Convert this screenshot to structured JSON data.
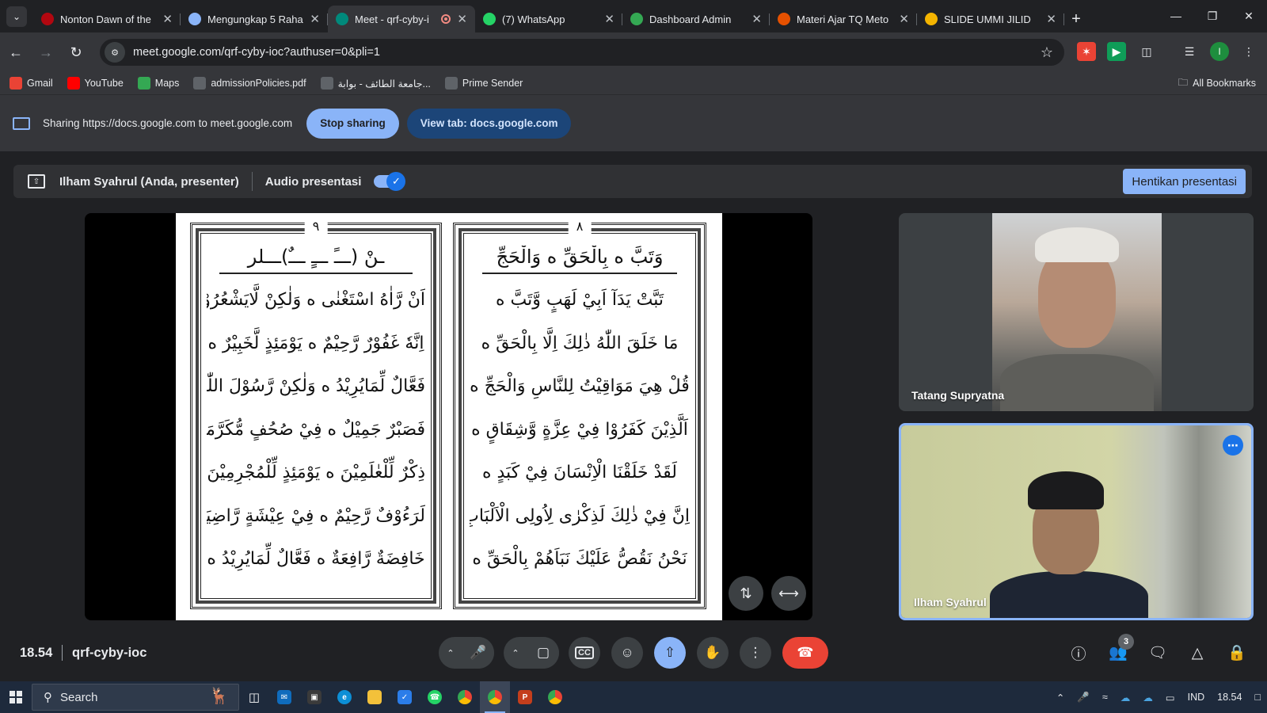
{
  "browser": {
    "tabs": [
      {
        "title": "Nonton Dawn of the",
        "favicon": "netflix-icon",
        "color": "#b20710"
      },
      {
        "title": "Mengungkap 5 Raha",
        "favicon": "sparkle-icon",
        "color": "#8ab4f8"
      },
      {
        "title": "Meet - qrf-cyby-i",
        "favicon": "meet-icon",
        "color": "#00897b",
        "active": true
      },
      {
        "title": "(7) WhatsApp",
        "favicon": "whatsapp-icon",
        "color": "#25d366"
      },
      {
        "title": "Dashboard Admin",
        "favicon": "dashboard-icon",
        "color": "#34a853"
      },
      {
        "title": "Materi Ajar TQ Meto",
        "favicon": "ummi-icon",
        "color": "#e65100"
      },
      {
        "title": "SLIDE UMMI JILID",
        "favicon": "slides-icon",
        "color": "#f4b400"
      }
    ],
    "url": "meet.google.com/qrf-cyby-ioc?authuser=0&pli=1",
    "profile_initial": "I",
    "bookmarks": [
      {
        "label": "Gmail",
        "icon": "gmail-icon",
        "color": "#ea4335"
      },
      {
        "label": "YouTube",
        "icon": "youtube-icon",
        "color": "#ff0000"
      },
      {
        "label": "Maps",
        "icon": "maps-icon",
        "color": "#34a853"
      },
      {
        "label": "admissionPolicies.pdf",
        "icon": "globe-icon",
        "color": "#5f6368"
      },
      {
        "label": "جامعة الطائف - بوابة...",
        "icon": "globe-icon",
        "color": "#5f6368"
      },
      {
        "label": "Prime Sender",
        "icon": "globe-icon",
        "color": "#5f6368"
      }
    ],
    "all_bookmarks": "All Bookmarks"
  },
  "sharing": {
    "text": "Sharing https://docs.google.com to meet.google.com",
    "stop_label": "Stop sharing",
    "view_label": "View tab: docs.google.com"
  },
  "meet": {
    "presenter_label": "Ilham Syahrul (Anda, presenter)",
    "audio_label": "Audio presentasi",
    "stop_presenting": "Hentikan presentasi",
    "doc": {
      "left_page_number": "٩",
      "right_page_number": "٨",
      "left_heading": "ـنْ (ـــً ـــٍ ـــٌ)ـــلر",
      "right_heading": "وَتَبَّ ﻩ بِالْحَقِّ ﻩ وَالْحَجِّ",
      "left_lines": [
        "اَنْ رَّاٰهُ اسْتَغْنٰى ﻩ وَلٰكِنْ لَّايَشْعُرُوْنَ ﻩ",
        "اِنَّهٗ غَفُوْرٌ رَّحِيْمٌ ﻩ يَوْمَئِذٍ لَّخَبِيْرٌ ﻩ",
        "فَعَّالٌ لِّمَايُرِيْدُ ﻩ وَلٰكِنْ رَّسُوْلَ اللّٰهِ ﻩ",
        "فَصَبْرٌ جَمِيْلٌ ﻩ فِيْ صُحُفٍ مُّكَرَّمَةٍ ﻩ",
        "ذِكْرٌ لِّلْعٰلَمِيْنَ ﻩ يَوْمَئِذٍ لِّلْمُجْرِمِيْنَ ﻩ",
        "لَرَءُوْفٌ رَّحِيْمٌ ﻩ فِيْ عِيْشَةٍ رَّاضِيَةٍ ﻩ",
        "خَافِضَةٌ رَّافِعَةٌ ﻩ فَعَّالٌ لِّمَايُرِيْدُ ﻩ"
      ],
      "right_lines": [
        "تَبَّتْ يَدَآ اَبِيْ لَهَبٍ وَّتَبَّ ﻩ",
        "مَا خَلَقَ اللّٰهُ ذٰلِكَ اِلَّا بِالْحَقِّ ﻩ",
        "قُلْ هِيَ مَوَاقِيْتُ لِلنَّاسِ وَالْحَجِّ ﻩ",
        "اَلَّذِيْنَ كَفَرُوْا فِيْ عِزَّةٍ وَّشِقَاقٍ ﻩ",
        "لَقَدْ خَلَقْنَا الْاِنْسَانَ فِيْ كَبَدٍ ﻩ",
        "اِنَّ فِيْ ذٰلِكَ لَذِكْرٰى لِاُولِى الْاَلْبَابِ ﻩ",
        "نَحْنُ نَقُصُّ عَلَيْكَ نَبَاَهُمْ بِالْحَقِّ ﻩ"
      ]
    },
    "participants": [
      {
        "name": "Tatang Supryatna"
      },
      {
        "name": "Ilham Syahrul"
      }
    ],
    "clock": "18.54",
    "meeting_code": "qrf-cyby-ioc",
    "people_count": "3"
  },
  "taskbar": {
    "search_placeholder": "Search",
    "language": "IND",
    "time": "18.54"
  }
}
